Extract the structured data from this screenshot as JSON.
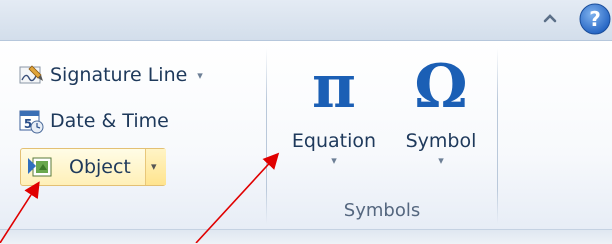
{
  "ribbon": {
    "insert_text_group": {
      "signature_line": {
        "label": "Signature Line",
        "dropdown": "▾",
        "icon": "signature-line-icon"
      },
      "date_time": {
        "label": "Date & Time",
        "icon": "calendar-clock-icon"
      },
      "object": {
        "label": "Object",
        "dropdown": "▾",
        "icon": "object-icon"
      }
    },
    "symbols_group": {
      "label": "Symbols",
      "equation": {
        "label": "Equation",
        "glyph": "π",
        "dropdown": "▾"
      },
      "symbol": {
        "label": "Symbol",
        "glyph": "Ω",
        "dropdown": "▾"
      }
    }
  },
  "window_controls": {
    "collapse_icon": "chevron-up-icon",
    "help_glyph": "?"
  },
  "colors": {
    "accent": "#1b5fb5",
    "hover_highlight": "#ffe48e",
    "annotation_arrow": "#e00000"
  }
}
